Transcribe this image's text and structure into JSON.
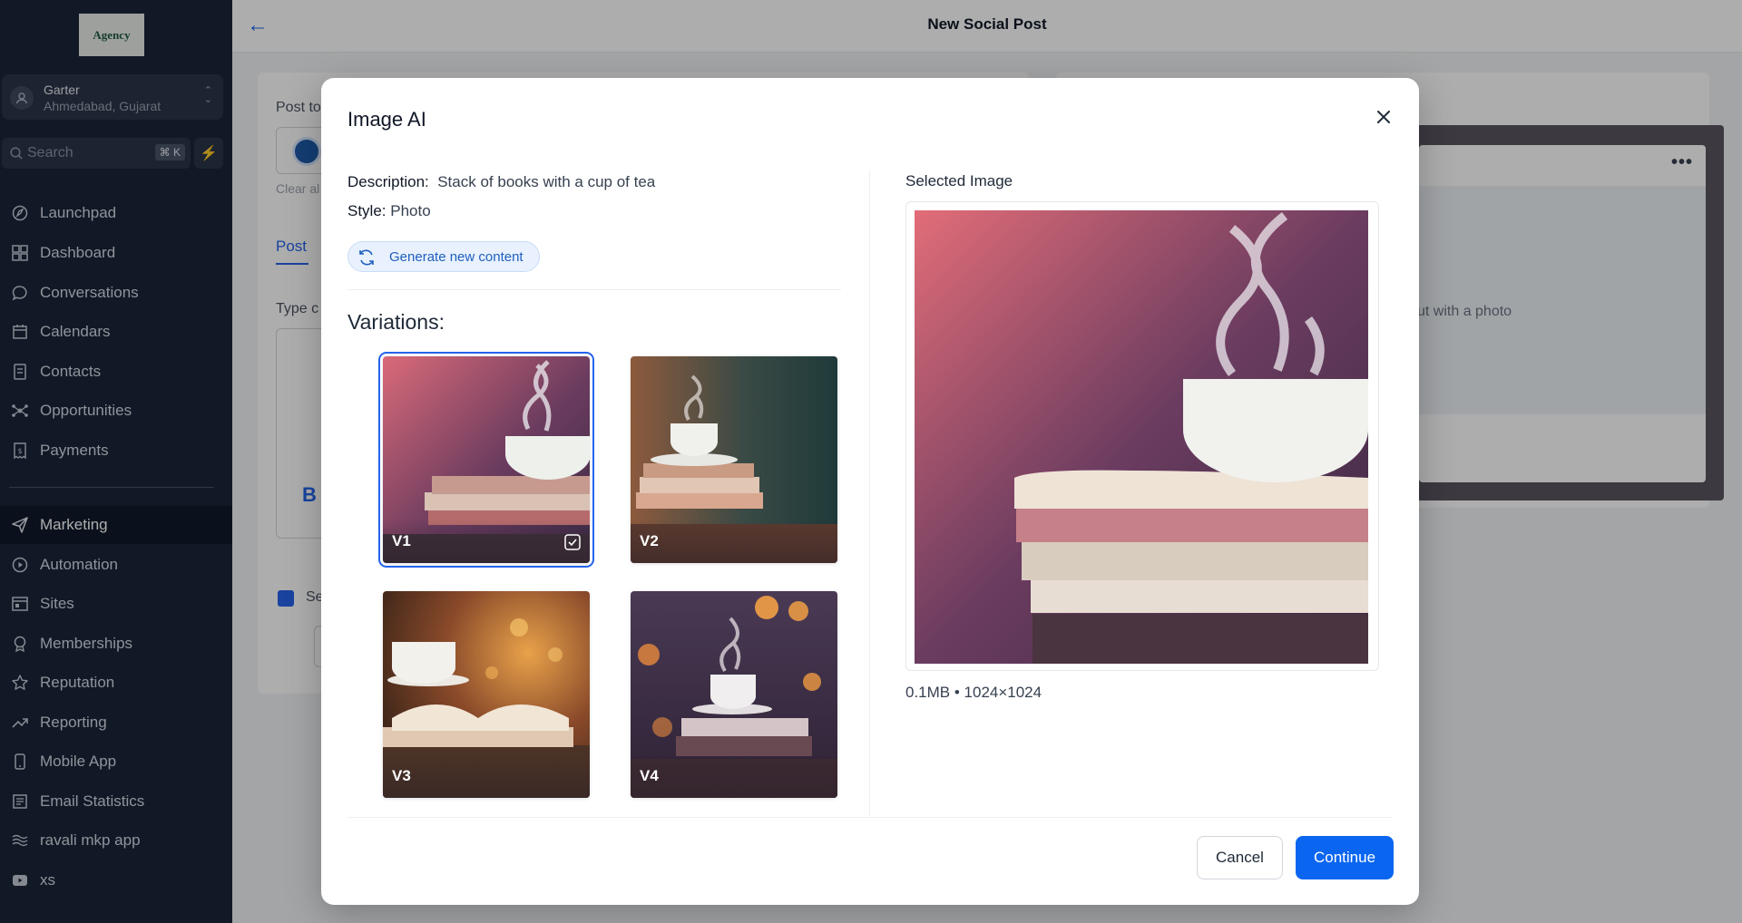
{
  "brand": {
    "logo_text": "Agency"
  },
  "account": {
    "name": "Garter",
    "location": "Ahmedabad, Gujarat"
  },
  "search": {
    "placeholder": "Search",
    "shortcut": "⌘ K"
  },
  "sidebar": {
    "items": [
      {
        "label": "Launchpad",
        "icon": "rocket-icon"
      },
      {
        "label": "Dashboard",
        "icon": "grid-icon"
      },
      {
        "label": "Conversations",
        "icon": "chat-bubble-icon"
      },
      {
        "label": "Calendars",
        "icon": "calendar-icon"
      },
      {
        "label": "Contacts",
        "icon": "contact-book-icon"
      },
      {
        "label": "Opportunities",
        "icon": "network-icon"
      },
      {
        "label": "Payments",
        "icon": "receipt-icon"
      }
    ],
    "items2": [
      {
        "label": "Marketing",
        "icon": "paper-plane-icon",
        "active": true
      },
      {
        "label": "Automation",
        "icon": "play-circle-icon"
      },
      {
        "label": "Sites",
        "icon": "browser-icon"
      },
      {
        "label": "Memberships",
        "icon": "badge-icon"
      },
      {
        "label": "Reputation",
        "icon": "star-icon"
      },
      {
        "label": "Reporting",
        "icon": "trend-icon"
      },
      {
        "label": "Mobile App",
        "icon": "phone-icon"
      },
      {
        "label": "Email Statistics",
        "icon": "email-stats-icon"
      },
      {
        "label": "ravali mkp app",
        "icon": "waves-icon"
      },
      {
        "label": "xs",
        "icon": "video-icon"
      }
    ]
  },
  "header": {
    "title": "New Social Post"
  },
  "background": {
    "post_to": "Post to",
    "clear_all": "Clear al",
    "tab_post": "Post",
    "type_content": "Type c",
    "bold": "B",
    "se": "Se",
    "preview_text": "ut with a photo"
  },
  "modal": {
    "title": "Image AI",
    "description_label": "Description:",
    "description_value": "Stack of books with a cup of tea",
    "style_label": "Style:",
    "style_value": "Photo",
    "generate_label": "Generate new content",
    "variations_title": "Variations:",
    "variations": [
      {
        "label": "V1",
        "selected": true
      },
      {
        "label": "V2",
        "selected": false
      },
      {
        "label": "V3",
        "selected": false
      },
      {
        "label": "V4",
        "selected": false
      }
    ],
    "selected_title": "Selected Image",
    "selected_meta": "0.1MB • 1024×1024",
    "cancel_label": "Cancel",
    "continue_label": "Continue"
  },
  "colors": {
    "accent": "#0a66f0",
    "sidebar_bg": "#1b2639"
  }
}
